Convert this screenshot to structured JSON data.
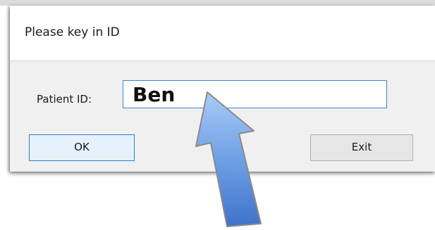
{
  "dialog": {
    "title": "Please key in ID",
    "field_label": "Patient ID:",
    "field_value": "Ben",
    "ok_label": "OK",
    "exit_label": "Exit"
  },
  "annotation": {
    "arrow_icon": "blue-arrow-icon",
    "arrow_color": "#5b8fdc"
  }
}
